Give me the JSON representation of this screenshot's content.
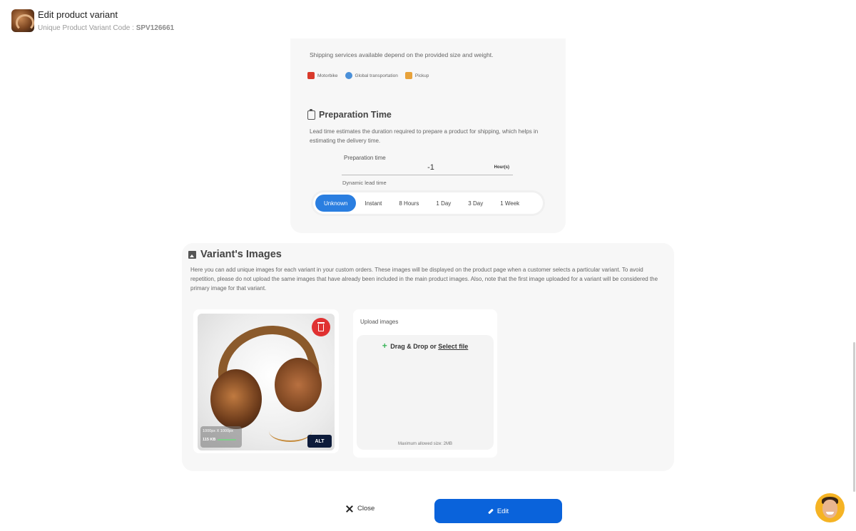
{
  "header": {
    "title": "Edit product variant",
    "code_label": "Unique Product Variant Code :",
    "code_value": "SPV126661"
  },
  "shipping": {
    "description": "Shipping services available depend on the provided size and weight.",
    "options": [
      {
        "label": "Motorbike",
        "icon": "motorbike-icon"
      },
      {
        "label": "Global transportation",
        "icon": "globe-icon"
      },
      {
        "label": "Pickup",
        "icon": "pickup-icon"
      }
    ]
  },
  "preparation": {
    "title": "Preparation Time",
    "description": "Lead time estimates the duration required to prepare a product for shipping, which helps in estimating the delivery time.",
    "field_label": "Preparation time",
    "value": "-1",
    "unit": "Hour(s)",
    "dynamic_label": "Dynamic lead time",
    "options": [
      "Unknown",
      "Instant",
      "8 Hours",
      "1 Day",
      "3 Day",
      "1 Week"
    ],
    "selected": "Unknown"
  },
  "images": {
    "title": "Variant's Images",
    "description": "Here you can add unique images for each variant in your custom orders. These images will be displayed on the product page when a customer selects a particular variant. To avoid repetition, please do not upload the same images that have already been included in the main product images. Also, note that the first image uploaded for a variant will be considered the primary image for that variant.",
    "item": {
      "dimensions": "1000px X 1000px",
      "size": "115 KB",
      "alt_label": "ALT"
    },
    "upload": {
      "label": "Upload images",
      "drag_text": "Drag & Drop or",
      "select_text": "Select file",
      "max_size": "Maximum allowed size: 2MB"
    }
  },
  "footer": {
    "close_label": "Close",
    "edit_label": "Edit"
  },
  "colors": {
    "accent": "#0a63db",
    "segment_active": "#2a7ee0",
    "delete": "#e03131"
  }
}
